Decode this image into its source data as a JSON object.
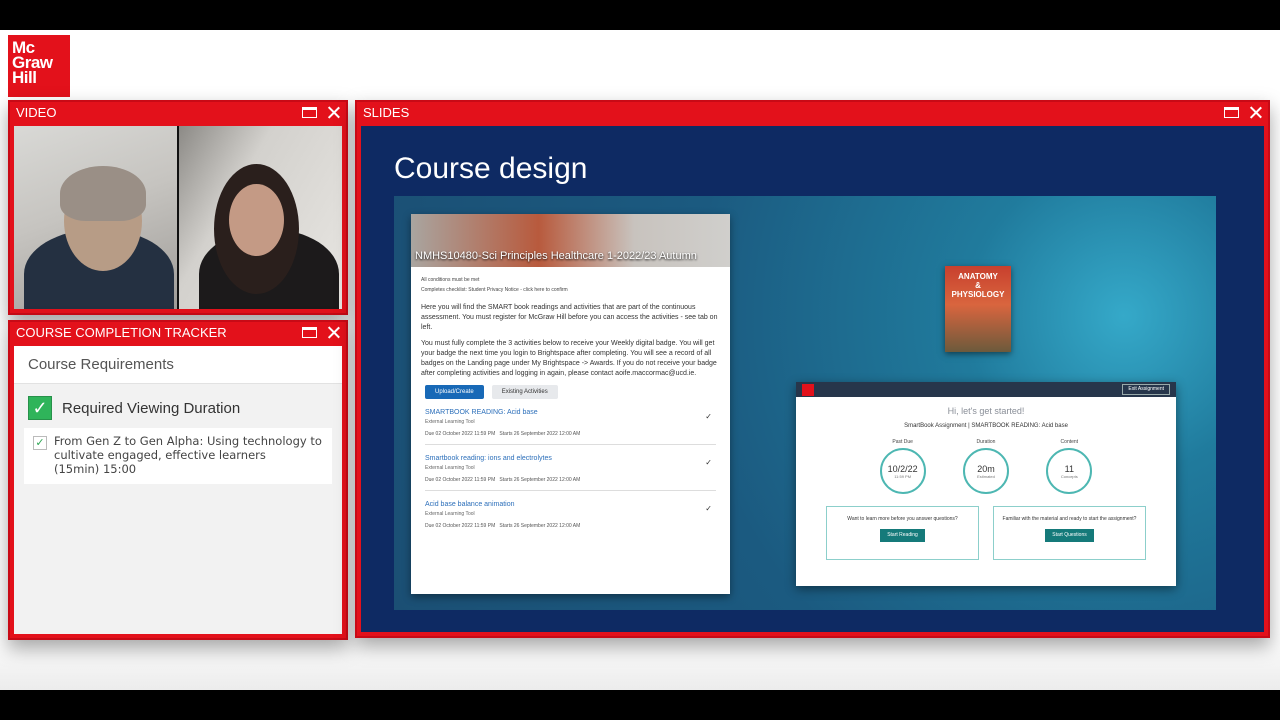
{
  "brand": {
    "logo_lines": [
      "Mc",
      "Graw",
      "Hill"
    ],
    "color": "#e3111b"
  },
  "video_panel": {
    "title": "VIDEO"
  },
  "tracker_panel": {
    "title": "COURSE COMPLETION TRACKER",
    "requirements_heading": "Course Requirements",
    "requirement": {
      "label": "Required Viewing Duration",
      "status": "complete"
    },
    "items": [
      {
        "line1": "From Gen Z to Gen Alpha: Using technology to",
        "line2": "cultivate engaged, effective learners",
        "line3": "(15min) 15:00"
      }
    ]
  },
  "slides_panel": {
    "title": "SLIDES",
    "slide_title": "Course design",
    "lms": {
      "course_title": "NMHS10480-Sci Principles Healthcare 1-2022/23 Autumn",
      "conditions": "All conditions must be met",
      "checklist": "Completes checklist: Student Privacy Notice - click here to confirm",
      "para1": "Here you will find the SMART book readings and activities that are part of the continuous assessment. You must register for McGraw Hill before you can access the activities - see tab on left.",
      "para2": "You must fully complete the 3 activities below to receive your Weekly digital badge. You will get your badge the next time you login to Brightspace after completing. You will see a record of all badges on the Landing page under My Brightspace -> Awards. If you do not receive your badge after completing activities and logging in again, please contact aoife.maccormac@ucd.ie.",
      "upload_button": "Upload/Create",
      "existing_button": "Existing Activities",
      "activities": [
        {
          "title": "SMARTBOOK READING: Acid base",
          "type": "External Learning Tool",
          "due": "Due 02 October 2022 11:59 PM",
          "starts": "Starts 26 September 2022 12:00 AM"
        },
        {
          "title": "Smartbook reading: ions and electrolytes",
          "type": "External Learning Tool",
          "due": "Due 02 October 2022 11:59 PM",
          "starts": "Starts 26 September 2022 12:00 AM"
        },
        {
          "title": "Acid base balance animation",
          "type": "External Learning Tool",
          "due": "Due 02 October 2022 11:59 PM",
          "starts": "Starts 26 September 2022 12:00 AM"
        }
      ]
    },
    "book": {
      "line1": "ANATOMY",
      "line2": "&",
      "line3": "PHYSIOLOGY"
    },
    "smartbook": {
      "exit_button": "Exit Assignment",
      "greeting": "Hi, let's get started!",
      "subtitle": "SmartBook Assignment | SMARTBOOK READING: Acid base",
      "stats": [
        {
          "label": "Past Due",
          "value": "10/2/22",
          "unit": "11:59 PM"
        },
        {
          "label": "Duration",
          "value": "20m",
          "unit": "Estimated"
        },
        {
          "label": "Content",
          "value": "11",
          "unit": "Concepts"
        }
      ],
      "box_left": {
        "text": "Want to learn more before you answer questions?",
        "button": "Start Reading"
      },
      "box_right": {
        "text": "Familiar with the material and ready to start the assignment?",
        "button": "Start Questions"
      }
    }
  }
}
